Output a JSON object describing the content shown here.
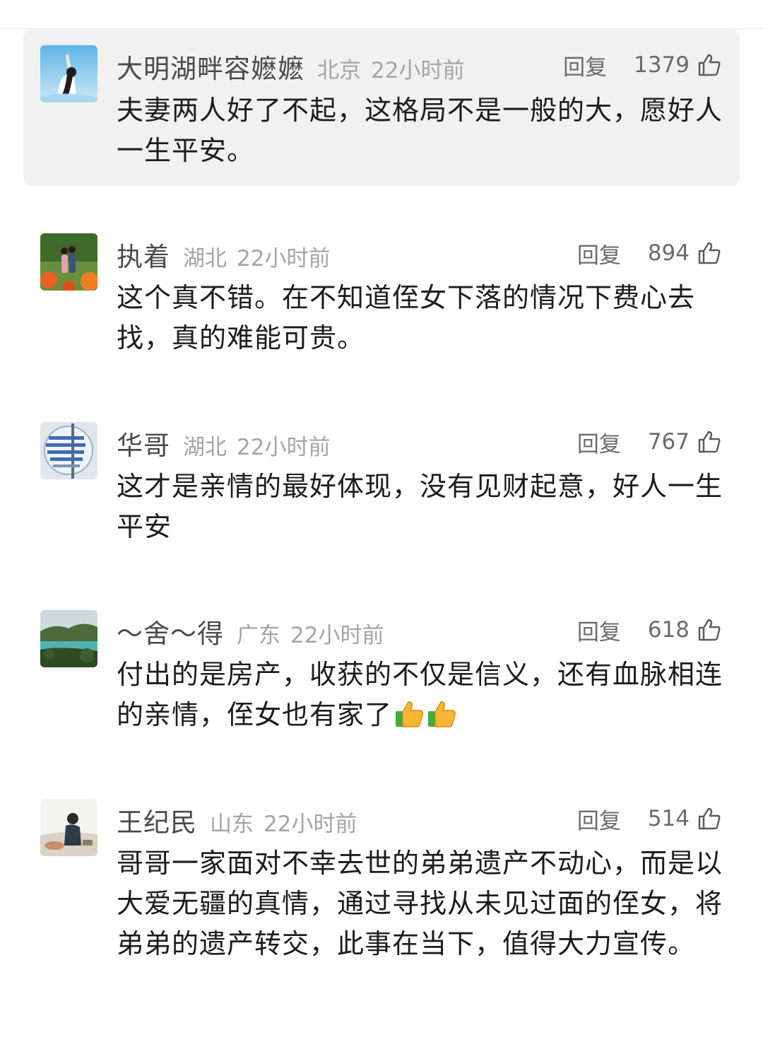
{
  "comments": [
    {
      "username": "大明湖畔容嬷嬷",
      "location": "北京",
      "time": "22小时前",
      "reply_label": "回复",
      "likes": "1379",
      "text": "夫妻两人好了不起，这格局不是一般的大，愿好人一生平安。",
      "highlighted": true,
      "avatar_icon": "person-arm-raised-sky-avatar"
    },
    {
      "username": "执着",
      "location": "湖北",
      "time": "22小时前",
      "reply_label": "回复",
      "likes": "894",
      "text": "这个真不错。在不知道侄女下落的情况下费心去找，真的难能可贵。",
      "highlighted": false,
      "avatar_icon": "couple-flowers-avatar"
    },
    {
      "username": "华哥",
      "location": "湖北",
      "time": "22小时前",
      "reply_label": "回复",
      "likes": "767",
      "text": "这才是亲情的最好体现，没有见财起意，好人一生平安",
      "highlighted": false,
      "avatar_icon": "text-badge-avatar"
    },
    {
      "username": "～舍～得",
      "location": "广东",
      "time": "22小时前",
      "reply_label": "回复",
      "likes": "618",
      "text": "付出的是房产，收获的不仅是信义，还有血脉相连的亲情，侄女也有家了",
      "text_emoji": [
        "thumbs-up-emoji",
        "thumbs-up-emoji"
      ],
      "highlighted": false,
      "avatar_icon": "lake-landscape-avatar"
    },
    {
      "username": "王纪民",
      "location": "山东",
      "time": "22小时前",
      "reply_label": "回复",
      "likes": "514",
      "text": "哥哥一家面对不幸去世的弟弟遗产不动心，而是以大爱无疆的真情，通过寻找从未见过面的侄女，将弟弟的遗产转交，此事在当下，值得大力宣传。",
      "highlighted": false,
      "avatar_icon": "man-outdoor-avatar"
    }
  ],
  "colors": {
    "highlight_bg": "#f1f1f1",
    "username": "#4a4a4a",
    "meta": "#a4a4a4",
    "action": "#6b6b6b",
    "text": "#1c1c1c"
  }
}
